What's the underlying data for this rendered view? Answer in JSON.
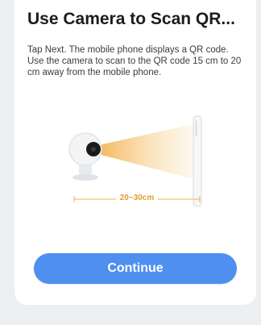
{
  "page": {
    "title": "Use Camera to Scan QR...",
    "description": "Tap Next. The mobile phone displays a QR code. Use the camera to scan to the QR code 15 cm to 20 cm away from the mobile phone."
  },
  "illustration": {
    "distance_label": "20~30cm",
    "icons": [
      "camera-icon",
      "phone-icon",
      "scan-beam"
    ]
  },
  "actions": {
    "continue_label": "Continue"
  },
  "colors": {
    "background": "#eceef1",
    "card": "#ffffff",
    "accent_button": "#4e8ff0",
    "distance_accent": "#e69a2e",
    "beam": "#f5c57a"
  }
}
